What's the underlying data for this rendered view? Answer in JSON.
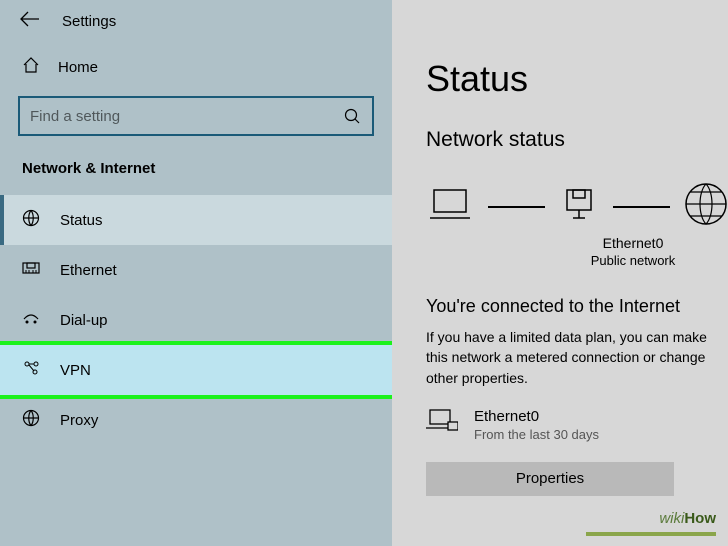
{
  "header": {
    "title": "Settings"
  },
  "home": {
    "label": "Home"
  },
  "search": {
    "placeholder": "Find a setting"
  },
  "category": {
    "label": "Network & Internet"
  },
  "nav": {
    "status": "Status",
    "ethernet": "Ethernet",
    "dialup": "Dial-up",
    "vpn": "VPN",
    "proxy": "Proxy"
  },
  "main": {
    "heading": "Status",
    "subheading": "Network status",
    "adapter_name": "Ethernet0",
    "adapter_type": "Public network",
    "connected_title": "You're connected to the Internet",
    "connected_desc": "If you have a limited data plan, you can make this network a metered connection or change other properties.",
    "adapter_label": "Ethernet0",
    "adapter_sub": "From the last 30 days",
    "properties_btn": "Properties"
  },
  "watermark": {
    "prefix": "wiki",
    "suffix": "How"
  }
}
